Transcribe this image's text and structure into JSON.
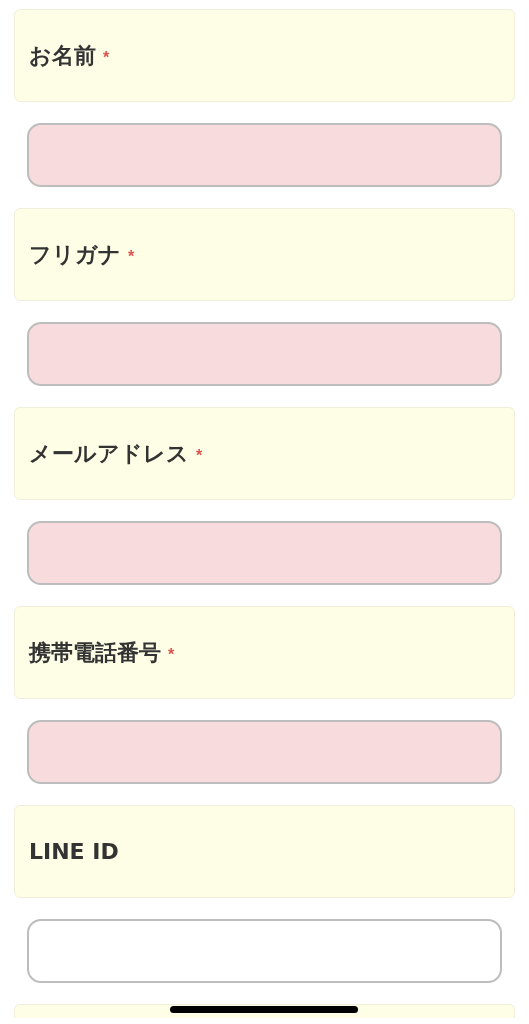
{
  "fields": [
    {
      "label": "お名前",
      "required_mark": "*",
      "required": true
    },
    {
      "label": "フリガナ",
      "required_mark": "*",
      "required": true
    },
    {
      "label": "メールアドレス",
      "required_mark": "*",
      "required": true
    },
    {
      "label": "携帯電話番号",
      "required_mark": "*",
      "required": true
    },
    {
      "label": "LINE ID",
      "required": false
    }
  ]
}
